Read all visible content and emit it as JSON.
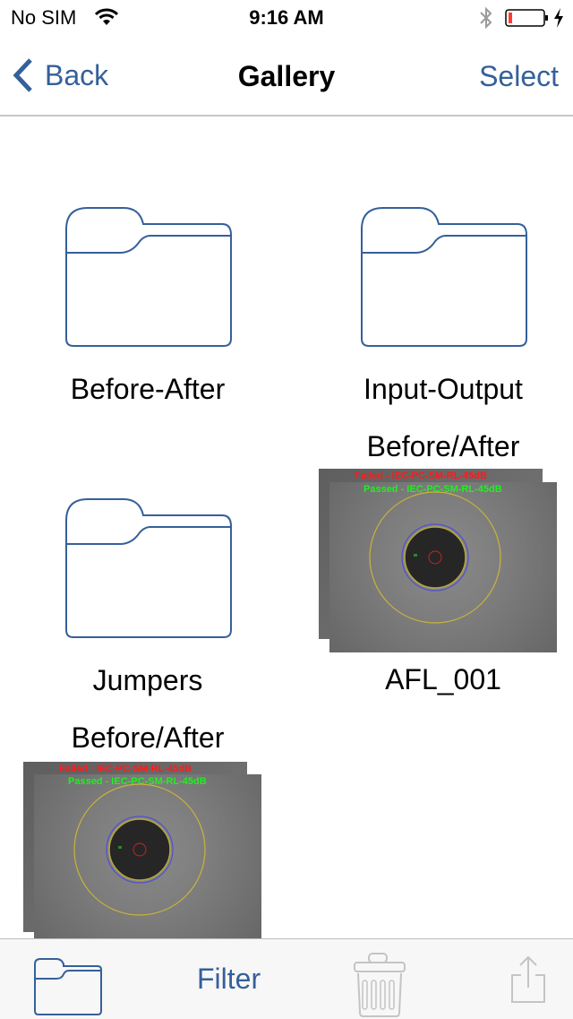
{
  "status_bar": {
    "carrier": "No SIM",
    "time": "9:16 AM",
    "battery_level_fraction": 0.08,
    "charging": true
  },
  "nav": {
    "back_label": "Back",
    "title": "Gallery",
    "select_label": "Select"
  },
  "items": [
    {
      "type": "folder",
      "label": "Before-After"
    },
    {
      "type": "folder",
      "label": "Input-Output"
    },
    {
      "type": "folder",
      "label": "Jumpers"
    },
    {
      "type": "image-stack",
      "header": "Before/After",
      "label": "AFL_001",
      "back_overlay": "Failed - IEC-PC-SM-RL-45dB",
      "front_overlay": "Passed - IEC-PC-SM-RL-45dB"
    },
    {
      "type": "image-stack",
      "header": "Before/After",
      "label": "",
      "back_overlay": "Failed - IEC-PC-SM-RL-45dB",
      "front_overlay": "Passed - IEC-PC-SM-RL-45dB"
    }
  ],
  "toolbar": {
    "filter_label": "Filter"
  },
  "colors": {
    "accent": "#35609a",
    "failed": "#ff1a1a",
    "passed": "#22ee22",
    "disabled": "#c4c4c4"
  }
}
